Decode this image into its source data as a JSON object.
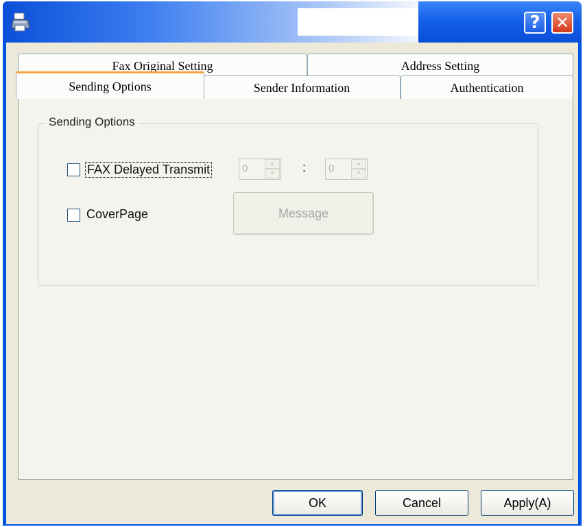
{
  "window": {
    "title": "",
    "help_glyph": "?",
    "close_glyph": "✕"
  },
  "tabs": {
    "back_row": [
      {
        "label": "Fax Original Setting"
      },
      {
        "label": "Address Setting"
      }
    ],
    "front_row": [
      {
        "label": "Sending Options",
        "active": true
      },
      {
        "label": "Sender Information"
      },
      {
        "label": "Authentication"
      }
    ]
  },
  "sending_options": {
    "group_title": "Sending Options",
    "fax_delayed": {
      "label": "FAX Delayed Transmit",
      "checked": false,
      "hour_value": "0",
      "minute_value": "0",
      "separator": ":"
    },
    "coverpage": {
      "label": "CoverPage",
      "checked": false,
      "message_button": "Message"
    }
  },
  "buttons": {
    "ok": "OK",
    "cancel": "Cancel",
    "apply": "Apply(A)"
  },
  "colors": {
    "titlebar_blue": "#0054e3",
    "dialog_bg": "#ece9d8",
    "tab_highlight": "#f3a53a"
  }
}
